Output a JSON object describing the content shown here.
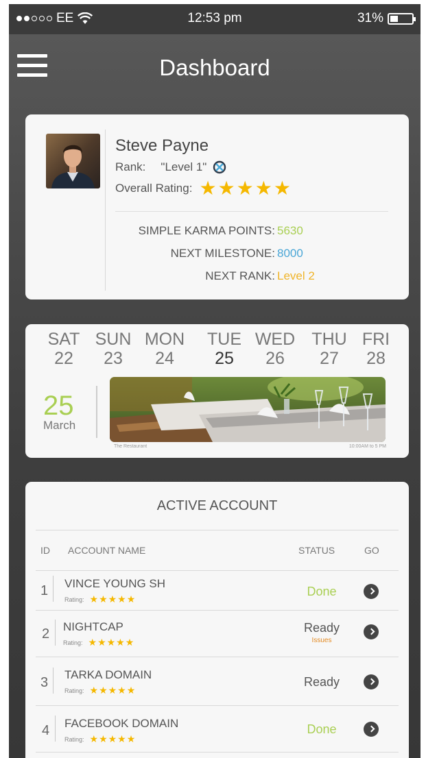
{
  "status_bar": {
    "carrier": "EE",
    "time": "12:53 pm",
    "battery": "31%",
    "battery_level": 0.31
  },
  "navbar": {
    "title": "Dashboard",
    "menu_icon": "hamburger-menu-icon"
  },
  "profile": {
    "name": "Steve Payne",
    "rank_label": "Rank:",
    "rank_value": "\"Level 1\"",
    "rank_icon": "badge-icon",
    "rating_label": "Overall Rating:",
    "rating_stars": "★★★★★",
    "rating_value": 5,
    "karma_label": "SIMPLE KARMA POINTS:",
    "karma_value": "5630",
    "milestone_label": "NEXT MILESTONE:",
    "milestone_value": "8000",
    "next_rank_label": "NEXT RANK:",
    "next_rank_value": "Level 2",
    "colors": {
      "karma": "#a9cf53",
      "milestone": "#4aa6d6",
      "next_rank": "#f0b429",
      "stars": "#f5b800"
    }
  },
  "calendar": {
    "days": [
      {
        "name": "SAT",
        "date": "22",
        "active": false
      },
      {
        "name": "SUN",
        "date": "23",
        "active": false
      },
      {
        "name": "MON",
        "date": "24",
        "active": false
      },
      {
        "name": "TUE",
        "date": "25",
        "active": true
      },
      {
        "name": "WED",
        "date": "26",
        "active": false
      },
      {
        "name": "THU",
        "date": "27",
        "active": false
      },
      {
        "name": "FRI",
        "date": "28",
        "active": false
      }
    ],
    "selected_day": "25",
    "selected_month": "March",
    "event": {
      "venue": "The Restaurant",
      "hours": "10:00AM to 5 PM"
    }
  },
  "accounts": {
    "title": "ACTIVE ACCOUNT",
    "headers": {
      "id": "ID",
      "name": "ACCOUNT NAME",
      "status": "STATUS",
      "go": "GO"
    },
    "rating_label": "Rating:",
    "rows": [
      {
        "id": "1",
        "name": "VINCE YOUNG SH",
        "stars": "★★★★★",
        "status": "Done",
        "status_color": "#a9cf53",
        "sub": ""
      },
      {
        "id": "2",
        "name": "NIGHTCAP",
        "stars": "★★★★★",
        "status": "Ready",
        "status_color": "#555555",
        "sub": "Issues"
      },
      {
        "id": "3",
        "name": "TARKA DOMAIN",
        "stars": "★★★★★",
        "status": "Ready",
        "status_color": "#555555",
        "sub": ""
      },
      {
        "id": "4",
        "name": "FACEBOOK DOMAIN",
        "stars": "★★★★★",
        "status": "Done",
        "status_color": "#a9cf53",
        "sub": ""
      }
    ]
  }
}
